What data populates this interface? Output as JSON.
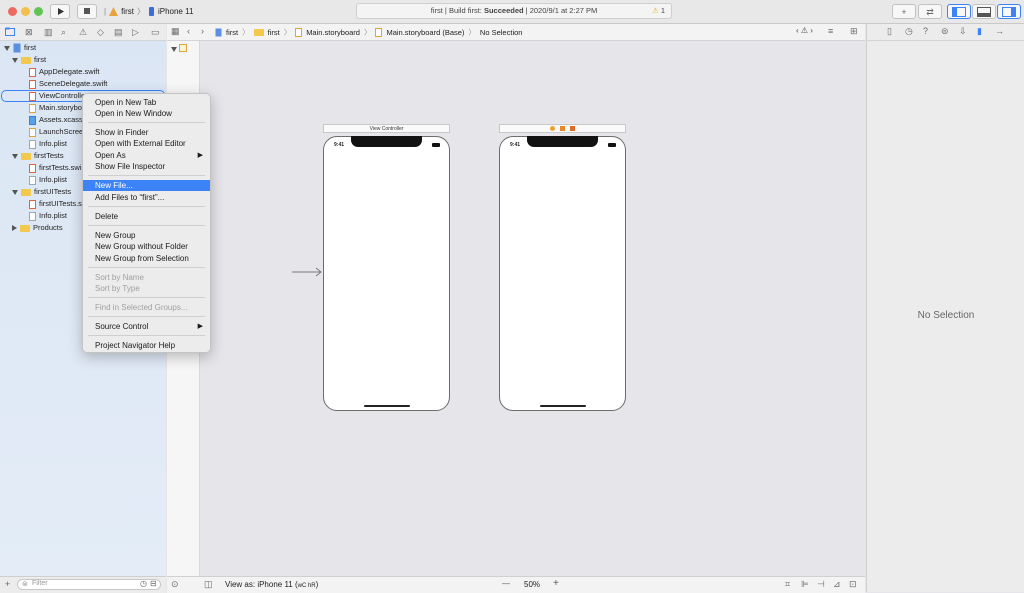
{
  "toolbar": {
    "scheme_name": "first",
    "device_name": "iPhone 11",
    "status_prefix": "first | Build first: ",
    "status_result": "Succeeded",
    "status_time": " | 2020/9/1 at 2:27 PM",
    "warning_count": "1"
  },
  "jumpbar": [
    "first",
    "first",
    "Main.storyboard",
    "Main.storyboard (Base)",
    "No Selection"
  ],
  "navigator": {
    "items": [
      {
        "label": "first",
        "type": "project"
      },
      {
        "label": "first",
        "type": "group"
      },
      {
        "label": "AppDelegate.swift",
        "type": "swift"
      },
      {
        "label": "SceneDelegate.swift",
        "type": "swift"
      },
      {
        "label": "ViewControlle",
        "type": "swift"
      },
      {
        "label": "Main.storybo",
        "type": "storyboard"
      },
      {
        "label": "Assets.xcass",
        "type": "assets"
      },
      {
        "label": "LaunchScree",
        "type": "storyboard"
      },
      {
        "label": "Info.plist",
        "type": "plist"
      },
      {
        "label": "firstTests",
        "type": "group"
      },
      {
        "label": "firstTests.swi",
        "type": "swift"
      },
      {
        "label": "Info.plist",
        "type": "plist"
      },
      {
        "label": "firstUITests",
        "type": "group"
      },
      {
        "label": "firstUITests.s",
        "type": "swift"
      },
      {
        "label": "Info.plist",
        "type": "plist"
      },
      {
        "label": "Products",
        "type": "group"
      }
    ],
    "filter_placeholder": "Filter"
  },
  "context_menu": {
    "items": [
      {
        "label": "Open in New Tab"
      },
      {
        "label": "Open in New Window"
      },
      {
        "label": "Show in Finder"
      },
      {
        "label": "Open with External Editor"
      },
      {
        "label": "Open As",
        "submenu": "▶"
      },
      {
        "label": "Show File Inspector"
      },
      {
        "label": "New File..."
      },
      {
        "label": "Add Files to “first”..."
      },
      {
        "label": "Delete"
      },
      {
        "label": "New Group"
      },
      {
        "label": "New Group without Folder"
      },
      {
        "label": "New Group from Selection"
      },
      {
        "label": "Sort by Name"
      },
      {
        "label": "Sort by Type"
      },
      {
        "label": "Find in Selected Groups..."
      },
      {
        "label": "Source Control",
        "submenu": "▶"
      },
      {
        "label": "Project Navigator Help"
      }
    ]
  },
  "canvas": {
    "scene1_title": "View Controller",
    "phone_time": "9:41",
    "view_as_label": "View as: iPhone 11 (",
    "view_as_traits": "wC hR",
    "view_as_close": ")",
    "zoom": "50%",
    "zoom_out": "—",
    "zoom_in": "+"
  },
  "inspector": {
    "empty_text": "No Selection"
  },
  "colors": {
    "accent": "#3b83f7",
    "selection": "#d6e4f5",
    "folder": "#f2c94c",
    "warning": "#f0b400"
  }
}
